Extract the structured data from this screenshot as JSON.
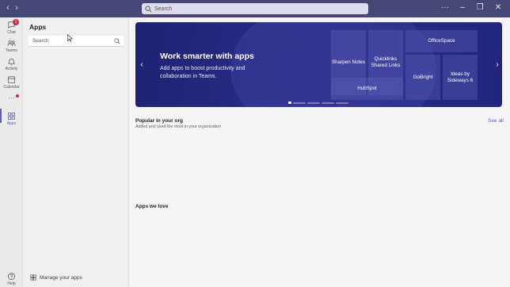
{
  "titlebar": {
    "search_placeholder": "Search",
    "more_label": "···"
  },
  "rail": {
    "items": [
      {
        "label": "Chat",
        "badge": "1"
      },
      {
        "label": "Teams"
      },
      {
        "label": "Activity"
      },
      {
        "label": "Calendar"
      },
      {
        "label": "Apps"
      },
      {
        "label": "Help"
      }
    ],
    "more": "···"
  },
  "sidepanel": {
    "title": "Apps",
    "search_placeholder": "Search",
    "manage_label": "Manage your apps"
  },
  "banner": {
    "headline": "Work smarter with apps",
    "subtext": "Add apps to boost productivity and collaboration in Teams.",
    "tiles": [
      "Sharpen Notes",
      "Quicklinks Shared Links",
      "OfficeSpace",
      "HubSpot",
      "GoBright",
      "Ideas by Sideways 6"
    ],
    "page_count": 5,
    "current_page": 1
  },
  "sections": {
    "popular_title": "Popular in your org",
    "popular_subtitle": "Added and used the most in your organization",
    "see_all": "See all",
    "loved_title": "Apps we love"
  },
  "colors": {
    "titlebar": "#464775",
    "accent": "#5b5fc7",
    "banner": "#23257a",
    "badge": "#c4314b"
  }
}
